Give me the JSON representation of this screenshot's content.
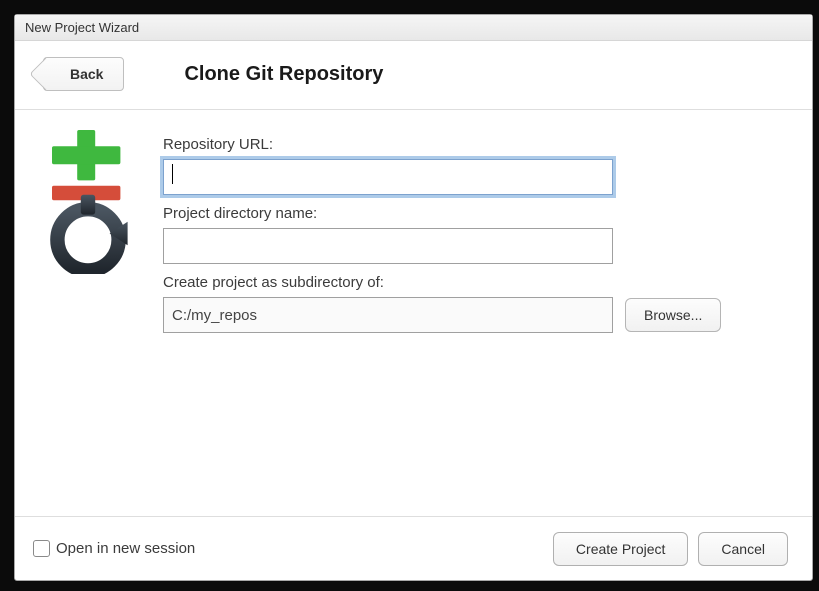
{
  "dialog": {
    "title": "New Project Wizard",
    "back_label": "Back",
    "heading": "Clone Git Repository"
  },
  "form": {
    "repo_url_label": "Repository URL:",
    "repo_url_value": "",
    "project_dir_label": "Project directory name:",
    "project_dir_value": "",
    "subdir_label": "Create project as subdirectory of:",
    "subdir_value": "C:/my_repos",
    "browse_label": "Browse..."
  },
  "footer": {
    "open_new_session_label": "Open in new session",
    "open_new_session_checked": false,
    "create_label": "Create Project",
    "cancel_label": "Cancel"
  },
  "icons": {
    "git_logo": "git-plus-icon"
  }
}
